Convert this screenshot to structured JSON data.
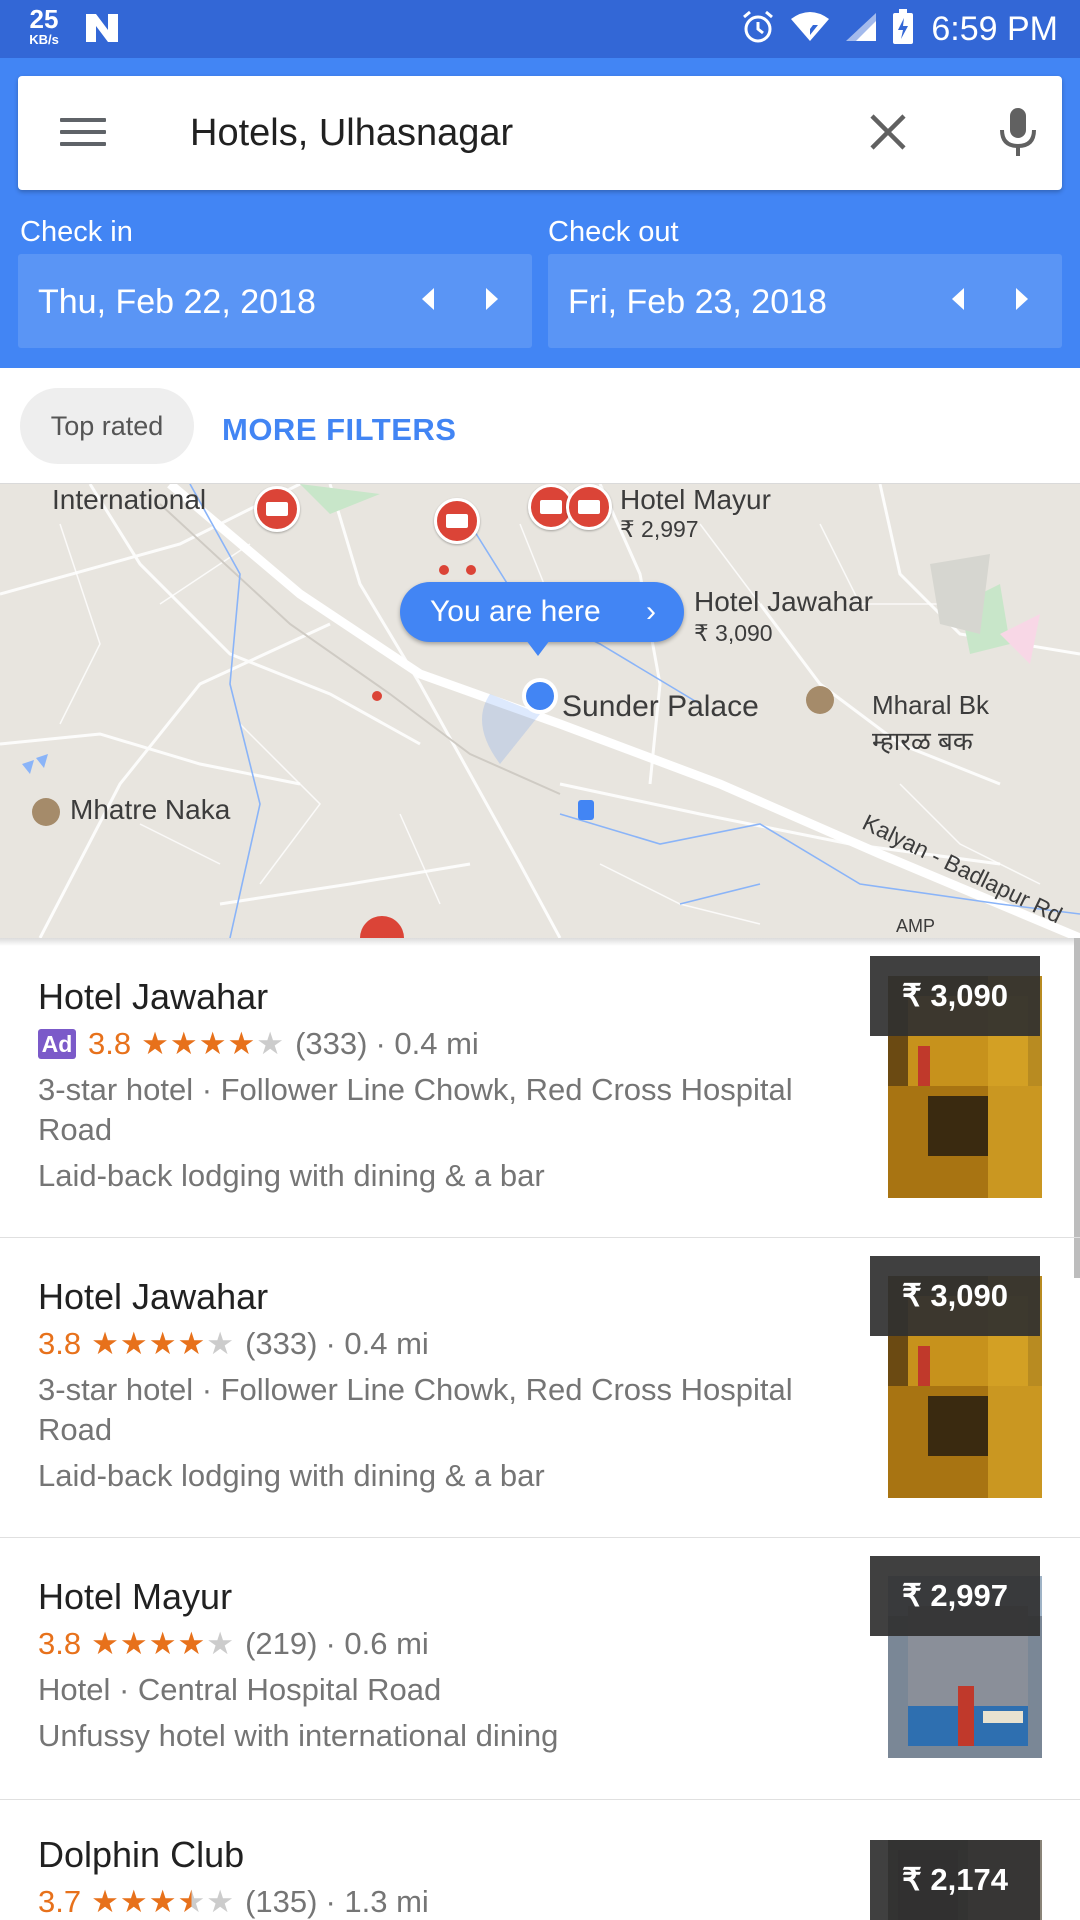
{
  "status_bar": {
    "speed_value": "25",
    "speed_unit": "KB/s",
    "time": "6:59 PM",
    "icons": [
      "n-notification-icon",
      "alarm-icon",
      "wifi-icon",
      "signal-icon",
      "battery-icon"
    ]
  },
  "search": {
    "query": "Hotels, Ulhasnagar"
  },
  "dates": {
    "check_in_label": "Check in",
    "check_in_value": "Thu, Feb 22, 2018",
    "check_out_label": "Check out",
    "check_out_value": "Fri, Feb 23, 2018"
  },
  "filters": {
    "chip_label": "Top rated",
    "more_label": "MORE FILTERS"
  },
  "map": {
    "you_are_here": "You are here",
    "labels": {
      "international": "International",
      "hotel_mayur": "Hotel Mayur",
      "hotel_mayur_price": "₹ 2,997",
      "hotel_jawahar": "Hotel Jawahar",
      "hotel_jawahar_price": "₹ 3,090",
      "sunder_palace": "Sunder Palace",
      "mharal_bk": "Mharal Bk",
      "mharal_bk_marathi": "म्हारळ बक",
      "mhatre_naka": "Mhatre Naka",
      "road": "Kalyan - Badlapur Rd",
      "amp": "AMP"
    }
  },
  "colors": {
    "status_bar": "#3367d6",
    "header": "#4285f4",
    "accent": "#4285f4",
    "rating": "#e7711b",
    "marker": "#db4437",
    "ad_badge": "#7b5ac9"
  },
  "results": [
    {
      "name": "Hotel Jawahar",
      "ad": "Ad",
      "rating": "3.8",
      "stars_on": 4,
      "stars_half": 0,
      "reviews": "(333)",
      "distance": "· 0.4 mi",
      "type_address": "3-star hotel · Follower Line Chowk, Red Cross Hospital Road",
      "description": "Laid-back lodging with dining & a bar",
      "price": "₹ 3,090"
    },
    {
      "name": "Hotel Jawahar",
      "rating": "3.8",
      "stars_on": 4,
      "stars_half": 0,
      "reviews": "(333)",
      "distance": "· 0.4 mi",
      "type_address": "3-star hotel · Follower Line Chowk, Red Cross Hospital Road",
      "description": "Laid-back lodging with dining & a bar",
      "price": "₹ 3,090"
    },
    {
      "name": "Hotel Mayur",
      "rating": "3.8",
      "stars_on": 4,
      "stars_half": 0,
      "reviews": "(219)",
      "distance": "· 0.6 mi",
      "type_address": "Hotel · Central Hospital Road",
      "description": "Unfussy hotel with international dining",
      "price": "₹ 2,997"
    },
    {
      "name": "Dolphin Club",
      "rating": "3.7",
      "stars_on": 3,
      "stars_half": 1,
      "reviews": "(135)",
      "distance": "· 1.3 mi",
      "price": "₹ 2,174"
    }
  ]
}
